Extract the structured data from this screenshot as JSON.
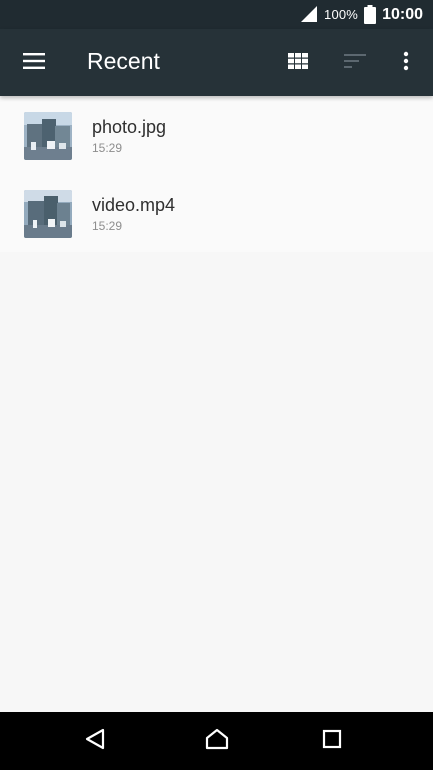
{
  "status_bar": {
    "battery_percent": "100%",
    "time": "10:00"
  },
  "toolbar": {
    "title": "Recent",
    "menu_icon": "hamburger-menu-icon",
    "grid_icon": "grid-view-icon",
    "sort_icon": "sort-icon",
    "overflow_icon": "more-vert-icon"
  },
  "files": [
    {
      "name": "photo.jpg",
      "time": "15:29"
    },
    {
      "name": "video.mp4",
      "time": "15:29"
    }
  ],
  "nav_bar": {
    "back_icon": "back-icon",
    "home_icon": "home-icon",
    "recents_icon": "recents-icon"
  },
  "colors": {
    "status_bar": "#202b31",
    "toolbar": "#263238",
    "background": "#f7f7f7",
    "nav_bar": "#000000"
  }
}
